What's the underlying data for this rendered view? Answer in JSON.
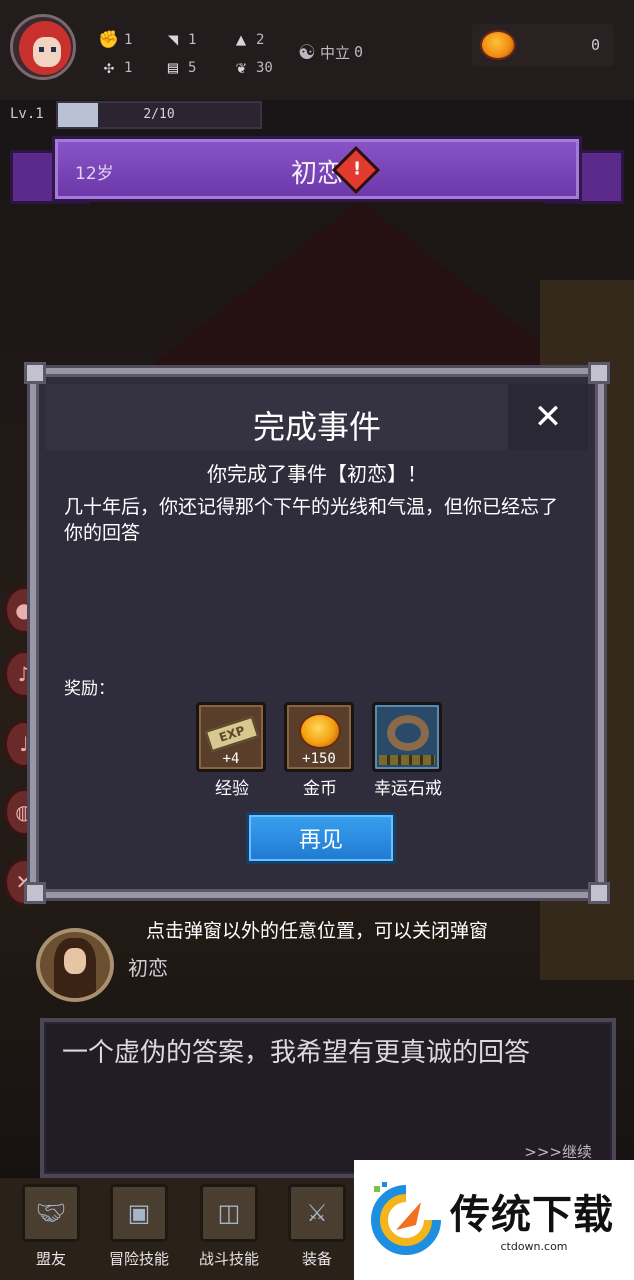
{
  "hud": {
    "stats": [
      {
        "icon": "fist-icon",
        "value": "1"
      },
      {
        "icon": "feather-icon",
        "value": "1"
      },
      {
        "icon": "wizard-hat-icon",
        "value": "2"
      },
      {
        "icon": "clover-icon",
        "value": "1"
      },
      {
        "icon": "book-icon",
        "value": "5"
      },
      {
        "icon": "leaf-icon",
        "value": "30"
      }
    ],
    "alignment_label": "中立",
    "alignment_value": "0",
    "coins": "0",
    "level": "Lv.1",
    "exp_text": "2/10",
    "exp_progress": 0.2
  },
  "event": {
    "age": "12岁",
    "title": "初恋",
    "warning_glyph": "!"
  },
  "dialog": {
    "title": "完成事件",
    "close_glyph": "✕",
    "subtitle": "你完成了事件【初恋】！",
    "body": "几十年后，你还记得那个下午的光线和气温，但你已经忘了你的回答",
    "reward_label": "奖励：",
    "rewards": [
      {
        "icon": "exp-scroll-icon",
        "badge": "EXP",
        "qty": "+4",
        "name": "经验"
      },
      {
        "icon": "gold-coin-icon",
        "qty": "+150",
        "name": "金币"
      },
      {
        "icon": "ring-icon",
        "qty": "",
        "name": "幸运石戒"
      }
    ],
    "confirm_label": "再见"
  },
  "hint": "点击弹窗以外的任意位置，可以关闭弹窗",
  "npc": {
    "name": "初恋"
  },
  "textbox": {
    "text": "一个虚伪的答案，我希望有更真诚的回答",
    "continue": ">>>继续"
  },
  "nav": [
    {
      "label": "盟友",
      "icon": "handshake-icon"
    },
    {
      "label": "冒险技能",
      "icon": "spellbook-icon"
    },
    {
      "label": "战斗技能",
      "icon": "backpack-icon"
    },
    {
      "label": "装备",
      "icon": "crossed-swords-icon"
    }
  ],
  "watermark": {
    "title": "传统下载",
    "url": "ctdown.com"
  }
}
